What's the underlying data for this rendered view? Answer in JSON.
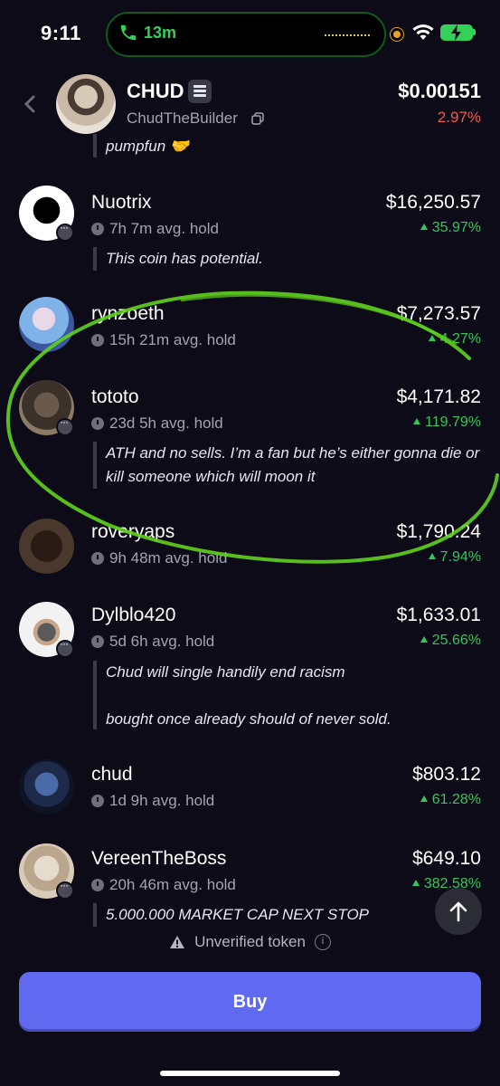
{
  "status_bar": {
    "time": "9:11",
    "call_duration": "13m",
    "accent_green": "#34d158"
  },
  "header": {
    "token_name": "CHUD",
    "handle": "ChudTheBuilder",
    "price": "$0.00151",
    "change": "2.97%",
    "change_color": "#ef5a4e"
  },
  "cut_comment": "pumpfun 🤝",
  "holders": [
    {
      "name": "Nuotrix",
      "hold": "7h 7m avg. hold",
      "value": "$16,250.57",
      "gain": "35.97%",
      "comment": "This coin has potential."
    },
    {
      "name": "rynzoeth",
      "hold": "15h 21m avg. hold",
      "value": "$7,273.57",
      "gain": "4.27%",
      "comment": ""
    },
    {
      "name": "tototo",
      "hold": "23d 5h avg. hold",
      "value": "$4,171.82",
      "gain": "119.79%",
      "comment": "ATH and no sells. I’m a fan but he’s either gonna die or kill someone which will moon it"
    },
    {
      "name": "roveryaps",
      "hold": "9h 48m avg. hold",
      "value": "$1,790.24",
      "gain": "7.94%",
      "comment": ""
    },
    {
      "name": "Dylblo420",
      "hold": "5d 6h avg. hold",
      "value": "$1,633.01",
      "gain": "25.66%",
      "comment_line1": "Chud will single handily end racism",
      "comment_line2": "bought once already should of never sold."
    },
    {
      "name": "chud",
      "hold": "1d 9h avg. hold",
      "value": "$803.12",
      "gain": "61.28%",
      "comment": ""
    },
    {
      "name": "VereenTheBoss",
      "hold": "20h 46m avg. hold",
      "value": "$649.10",
      "gain": "382.58%",
      "comment": "5.000.000 MARKET CAP NEXT STOP"
    }
  ],
  "footer": {
    "unverified_label": "Unverified token",
    "buy_label": "Buy",
    "buy_color": "#5f6af0"
  },
  "icons": [
    "phone-icon",
    "wifi-icon",
    "battery-icon",
    "back-chevron-icon",
    "copy-icon",
    "clock-icon",
    "chat-bubble-icon",
    "arrow-up-icon",
    "warning-icon",
    "info-icon"
  ]
}
